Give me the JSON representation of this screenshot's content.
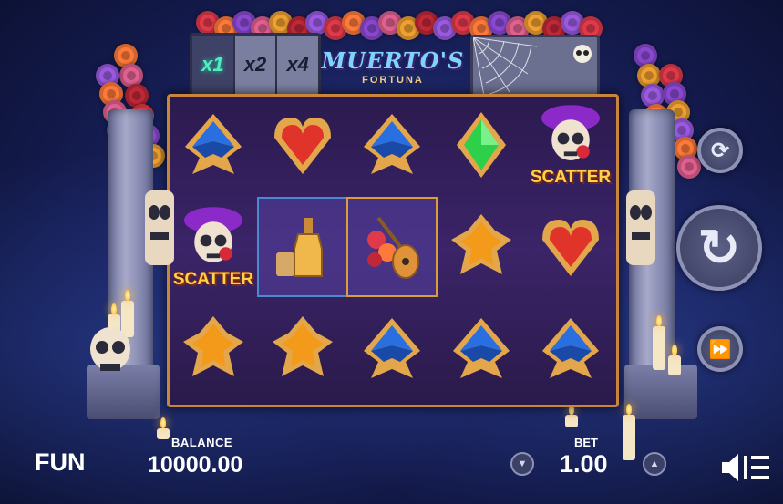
{
  "game": {
    "logo_title": "MUERTO'S",
    "logo_sub": "FORTUNA"
  },
  "multipliers": [
    {
      "label": "x1",
      "active": true
    },
    {
      "label": "x2",
      "active": false
    },
    {
      "label": "x4",
      "active": false
    }
  ],
  "reels": [
    [
      "blue-spade-icon",
      "red-heart-icon",
      "blue-spade-icon",
      "green-diamond-icon",
      "scatter-skull-icon"
    ],
    [
      "scatter-skull-icon",
      "tequila-bottle-icon",
      "guitar-roses-icon",
      "orange-club-icon",
      "red-heart-icon"
    ],
    [
      "orange-club-icon",
      "orange-club-icon",
      "blue-spade-icon",
      "blue-spade-icon",
      "blue-spade-icon"
    ]
  ],
  "scatter_label": "SCATTER",
  "bottom_bar": {
    "mode_label": "FUN",
    "balance_label": "BALANCE",
    "balance_value": "10000.00",
    "bet_label": "BET",
    "bet_value": "1.00"
  },
  "controls": {
    "autoplay_icon": "autoplay-icon",
    "spin_icon": "spin-icon",
    "turbo_icon": "turbo-icon",
    "menu_icon": "menu-sound-icon"
  },
  "colors": {
    "reel_frame": "#c9853a",
    "multiplier_active": "#4ef0c0",
    "spade_blue": "#2a6fe0",
    "heart_red": "#e0342a",
    "club_orange": "#f39a1a",
    "diamond_green": "#2ed04a"
  }
}
